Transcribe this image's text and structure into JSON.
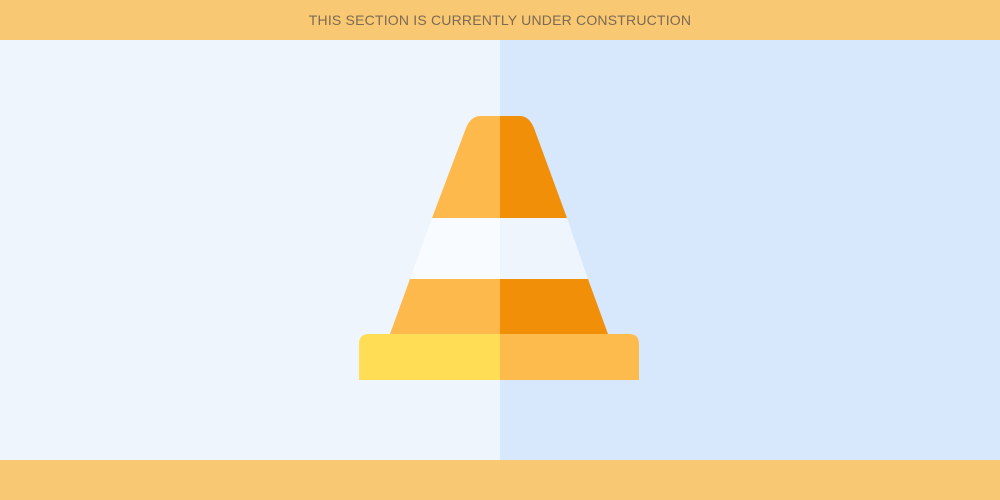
{
  "banner": {
    "message": "THIS SECTION IS CURRENTLY UNDER CONSTRUCTION"
  },
  "illustration": {
    "icon": "traffic-cone-icon",
    "colors": {
      "cone_light": "#FDB94C",
      "cone_dark": "#F28F08",
      "stripe_light": "#F8FBFF",
      "stripe_shade": "#EEF5FD",
      "base_light": "#FFDE55",
      "base_dark": "#FDBB4E"
    }
  },
  "theme": {
    "banner_color": "#F8C872",
    "left_panel": "#EEF5FD",
    "right_panel": "#D7E8FC"
  }
}
